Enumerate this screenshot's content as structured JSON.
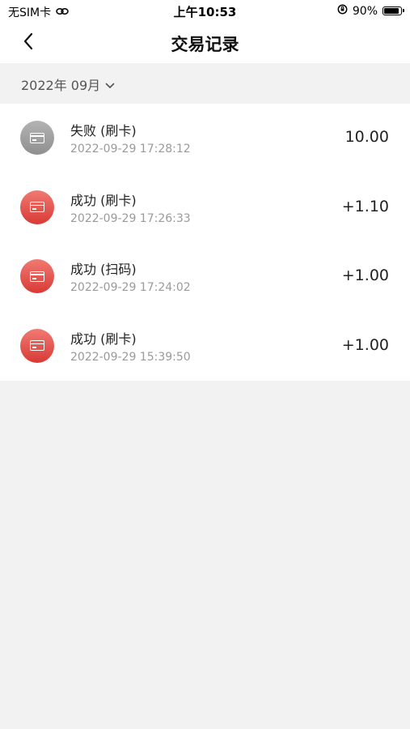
{
  "status_bar": {
    "carrier": "无SIM卡",
    "link_icon": "link-icon",
    "time": "上午10:53",
    "orientation_icon": "orientation-lock-icon",
    "battery_percent": "90%",
    "battery_level": 0.9
  },
  "nav": {
    "back_icon": "chevron-left-icon",
    "title": "交易记录"
  },
  "filter": {
    "month_label": "2022年 09月",
    "dropdown_icon": "chevron-down-icon"
  },
  "records": [
    {
      "status": "fail",
      "icon": "card-icon",
      "title": "失败 (刷卡)",
      "time": "2022-09-29 17:28:12",
      "amount": "10.00"
    },
    {
      "status": "success",
      "icon": "card-icon",
      "title": "成功 (刷卡)",
      "time": "2022-09-29 17:26:33",
      "amount": "+1.10"
    },
    {
      "status": "success",
      "icon": "card-icon",
      "title": "成功 (扫码)",
      "time": "2022-09-29 17:24:02",
      "amount": "+1.00"
    },
    {
      "status": "success",
      "icon": "card-icon",
      "title": "成功 (刷卡)",
      "time": "2022-09-29 15:39:50",
      "amount": "+1.00"
    }
  ],
  "colors": {
    "success_icon": "#e04a44",
    "fail_icon": "#a3a3a3",
    "background": "#f2f2f2"
  }
}
